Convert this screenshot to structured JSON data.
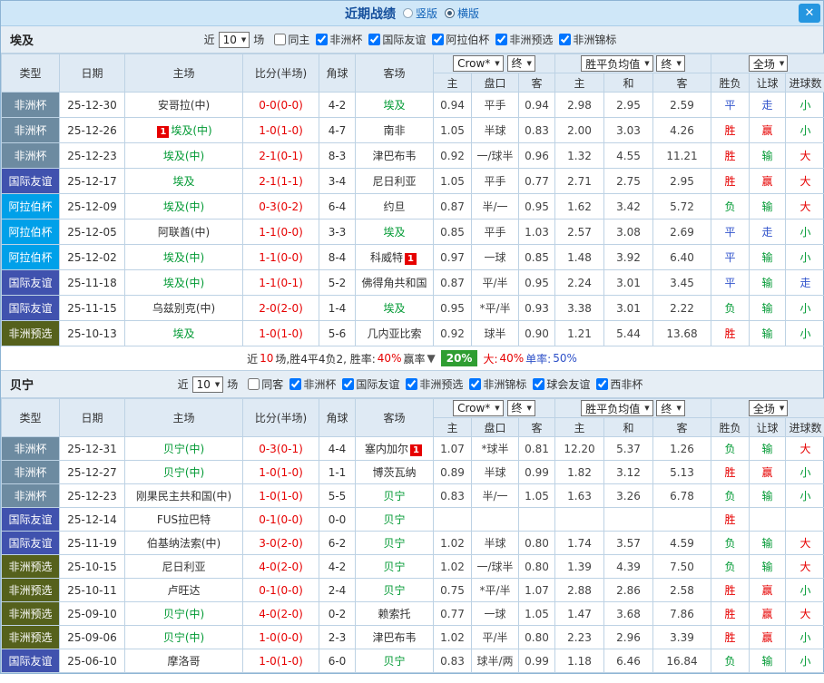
{
  "titlebar": {
    "title": "近期战绩",
    "radio_vertical": "竖版",
    "radio_horizontal": "横版",
    "close": "✕"
  },
  "filter": {
    "near_label": "近",
    "near_value": "10",
    "matches_label": "场"
  },
  "table_header": {
    "col_type": "类型",
    "col_date": "日期",
    "col_home": "主场",
    "col_score": "比分(半场)",
    "col_corner": "角球",
    "col_away": "客场",
    "odds_select1": "Crow*",
    "odds_select2": "终",
    "avg_select1": "胜平负均值",
    "avg_select2": "终",
    "scope_select": "全场",
    "sub_home": "主",
    "sub_handicap": "盘口",
    "sub_away": "客",
    "sub_avg_home": "主",
    "sub_avg_draw": "和",
    "sub_avg_away": "客",
    "col_result": "胜负",
    "col_handicap_result": "让球",
    "col_goals": "进球数"
  },
  "type_colors": {
    "非洲杯": "#6d8ba1",
    "国际友谊": "#4052ae",
    "阿拉伯杯": "#00a0e9",
    "非洲预选": "#55611c"
  },
  "result_colors": {
    "red": "#e60000",
    "green": "#009933",
    "blue": "#3355cc"
  },
  "sections": [
    {
      "team": "埃及",
      "filters": [
        {
          "label": "同主",
          "checked": false
        },
        {
          "label": "非洲杯",
          "checked": true
        },
        {
          "label": "国际友谊",
          "checked": true
        },
        {
          "label": "阿拉伯杯",
          "checked": true
        },
        {
          "label": "非洲预选",
          "checked": true
        },
        {
          "label": "非洲锦标",
          "checked": true
        }
      ],
      "rows": [
        {
          "type": "非洲杯",
          "date": "25-12-30",
          "home": "安哥拉(中)",
          "home_focus": false,
          "home_badge": "",
          "home_badge_pos": "",
          "score": "0-0(0-0)",
          "corner": "4-2",
          "away": "埃及",
          "away_focus": true,
          "away_badge": "",
          "away_badge_pos": "",
          "odds": [
            "0.94",
            "平手",
            "0.94"
          ],
          "avg": [
            "2.98",
            "2.95",
            "2.59"
          ],
          "results": [
            {
              "t": "平",
              "c": "blue"
            },
            {
              "t": "走",
              "c": "blue"
            },
            {
              "t": "小",
              "c": "green"
            }
          ]
        },
        {
          "type": "非洲杯",
          "date": "25-12-26",
          "home": "埃及(中)",
          "home_focus": true,
          "home_badge": "1",
          "home_badge_pos": "before",
          "score": "1-0(1-0)",
          "corner": "4-7",
          "away": "南非",
          "away_focus": false,
          "away_badge": "",
          "away_badge_pos": "",
          "odds": [
            "1.05",
            "半球",
            "0.83"
          ],
          "avg": [
            "2.00",
            "3.03",
            "4.26"
          ],
          "results": [
            {
              "t": "胜",
              "c": "red"
            },
            {
              "t": "赢",
              "c": "red"
            },
            {
              "t": "小",
              "c": "green"
            }
          ]
        },
        {
          "type": "非洲杯",
          "date": "25-12-23",
          "home": "埃及(中)",
          "home_focus": true,
          "home_badge": "",
          "home_badge_pos": "",
          "score": "2-1(0-1)",
          "corner": "8-3",
          "away": "津巴布韦",
          "away_focus": false,
          "away_badge": "",
          "away_badge_pos": "",
          "odds": [
            "0.92",
            "一/球半",
            "0.96"
          ],
          "avg": [
            "1.32",
            "4.55",
            "11.21"
          ],
          "results": [
            {
              "t": "胜",
              "c": "red"
            },
            {
              "t": "输",
              "c": "green"
            },
            {
              "t": "大",
              "c": "red"
            }
          ]
        },
        {
          "type": "国际友谊",
          "date": "25-12-17",
          "home": "埃及",
          "home_focus": true,
          "home_badge": "",
          "home_badge_pos": "",
          "score": "2-1(1-1)",
          "corner": "3-4",
          "away": "尼日利亚",
          "away_focus": false,
          "away_badge": "",
          "away_badge_pos": "",
          "odds": [
            "1.05",
            "平手",
            "0.77"
          ],
          "avg": [
            "2.71",
            "2.75",
            "2.95"
          ],
          "results": [
            {
              "t": "胜",
              "c": "red"
            },
            {
              "t": "赢",
              "c": "red"
            },
            {
              "t": "大",
              "c": "red"
            }
          ]
        },
        {
          "type": "阿拉伯杯",
          "date": "25-12-09",
          "home": "埃及(中)",
          "home_focus": true,
          "home_badge": "",
          "home_badge_pos": "",
          "score": "0-3(0-2)",
          "corner": "6-4",
          "away": "约旦",
          "away_focus": false,
          "away_badge": "",
          "away_badge_pos": "",
          "odds": [
            "0.87",
            "半/一",
            "0.95"
          ],
          "avg": [
            "1.62",
            "3.42",
            "5.72"
          ],
          "results": [
            {
              "t": "负",
              "c": "green"
            },
            {
              "t": "输",
              "c": "green"
            },
            {
              "t": "大",
              "c": "red"
            }
          ]
        },
        {
          "type": "阿拉伯杯",
          "date": "25-12-05",
          "home": "阿联酋(中)",
          "home_focus": false,
          "home_badge": "",
          "home_badge_pos": "",
          "score": "1-1(0-0)",
          "corner": "3-3",
          "away": "埃及",
          "away_focus": true,
          "away_badge": "",
          "away_badge_pos": "",
          "odds": [
            "0.85",
            "平手",
            "1.03"
          ],
          "avg": [
            "2.57",
            "3.08",
            "2.69"
          ],
          "results": [
            {
              "t": "平",
              "c": "blue"
            },
            {
              "t": "走",
              "c": "blue"
            },
            {
              "t": "小",
              "c": "green"
            }
          ]
        },
        {
          "type": "阿拉伯杯",
          "date": "25-12-02",
          "home": "埃及(中)",
          "home_focus": true,
          "home_badge": "",
          "home_badge_pos": "",
          "score": "1-1(0-0)",
          "corner": "8-4",
          "away": "科威特",
          "away_focus": false,
          "away_badge": "1",
          "away_badge_pos": "after",
          "odds": [
            "0.97",
            "一球",
            "0.85"
          ],
          "avg": [
            "1.48",
            "3.92",
            "6.40"
          ],
          "results": [
            {
              "t": "平",
              "c": "blue"
            },
            {
              "t": "输",
              "c": "green"
            },
            {
              "t": "小",
              "c": "green"
            }
          ]
        },
        {
          "type": "国际友谊",
          "date": "25-11-18",
          "home": "埃及(中)",
          "home_focus": true,
          "home_badge": "",
          "home_badge_pos": "",
          "score": "1-1(0-1)",
          "corner": "5-2",
          "away": "佛得角共和国",
          "away_focus": false,
          "away_badge": "",
          "away_badge_pos": "",
          "odds": [
            "0.87",
            "平/半",
            "0.95"
          ],
          "avg": [
            "2.24",
            "3.01",
            "3.45"
          ],
          "results": [
            {
              "t": "平",
              "c": "blue"
            },
            {
              "t": "输",
              "c": "green"
            },
            {
              "t": "走",
              "c": "blue"
            }
          ]
        },
        {
          "type": "国际友谊",
          "date": "25-11-15",
          "home": "乌兹别克(中)",
          "home_focus": false,
          "home_badge": "",
          "home_badge_pos": "",
          "score": "2-0(2-0)",
          "corner": "1-4",
          "away": "埃及",
          "away_focus": true,
          "away_badge": "",
          "away_badge_pos": "",
          "odds": [
            "0.95",
            "*平/半",
            "0.93"
          ],
          "avg": [
            "3.38",
            "3.01",
            "2.22"
          ],
          "results": [
            {
              "t": "负",
              "c": "green"
            },
            {
              "t": "输",
              "c": "green"
            },
            {
              "t": "小",
              "c": "green"
            }
          ]
        },
        {
          "type": "非洲预选",
          "date": "25-10-13",
          "home": "埃及",
          "home_focus": true,
          "home_badge": "",
          "home_badge_pos": "",
          "score": "1-0(1-0)",
          "corner": "5-6",
          "away": "几内亚比索",
          "away_focus": false,
          "away_badge": "",
          "away_badge_pos": "",
          "odds": [
            "0.92",
            "球半",
            "0.90"
          ],
          "avg": [
            "1.21",
            "5.44",
            "13.68"
          ],
          "results": [
            {
              "t": "胜",
              "c": "red"
            },
            {
              "t": "输",
              "c": "green"
            },
            {
              "t": "小",
              "c": "green"
            }
          ]
        }
      ],
      "summary": {
        "before": [
          {
            "t": "近",
            "c": "#333333"
          },
          {
            "t": "10",
            "c": "#e60000"
          },
          {
            "t": "场,胜4平4负2, 胜率:",
            "c": "#333333"
          },
          {
            "t": "40%",
            "c": "#e60000"
          },
          {
            "t": " 赢率",
            "c": "#333333"
          },
          {
            "t": "▼",
            "c": "#555555"
          }
        ],
        "badge": "20%",
        "badge_bg": "#2f9e32",
        "after": [
          {
            "t": "大:",
            "c": "#e60000"
          },
          {
            "t": "40%",
            "c": "#e60000"
          },
          {
            "t": " 单率:",
            "c": "#2d50c8"
          },
          {
            "t": "50%",
            "c": "#2d50c8"
          }
        ]
      }
    },
    {
      "team": "贝宁",
      "filters": [
        {
          "label": "同客",
          "checked": false
        },
        {
          "label": "非洲杯",
          "checked": true
        },
        {
          "label": "国际友谊",
          "checked": true
        },
        {
          "label": "非洲预选",
          "checked": true
        },
        {
          "label": "非洲锦标",
          "checked": true
        },
        {
          "label": "球会友谊",
          "checked": true
        },
        {
          "label": "西非杯",
          "checked": true
        }
      ],
      "rows": [
        {
          "type": "非洲杯",
          "date": "25-12-31",
          "home": "贝宁(中)",
          "home_focus": true,
          "home_badge": "",
          "home_badge_pos": "",
          "score": "0-3(0-1)",
          "corner": "4-4",
          "away": "塞内加尔",
          "away_focus": false,
          "away_badge": "1",
          "away_badge_pos": "after",
          "odds": [
            "1.07",
            "*球半",
            "0.81"
          ],
          "avg": [
            "12.20",
            "5.37",
            "1.26"
          ],
          "results": [
            {
              "t": "负",
              "c": "green"
            },
            {
              "t": "输",
              "c": "green"
            },
            {
              "t": "大",
              "c": "red"
            }
          ]
        },
        {
          "type": "非洲杯",
          "date": "25-12-27",
          "home": "贝宁(中)",
          "home_focus": true,
          "home_badge": "",
          "home_badge_pos": "",
          "score": "1-0(1-0)",
          "corner": "1-1",
          "away": "博茨瓦纳",
          "away_focus": false,
          "away_badge": "",
          "away_badge_pos": "",
          "odds": [
            "0.89",
            "半球",
            "0.99"
          ],
          "avg": [
            "1.82",
            "3.12",
            "5.13"
          ],
          "results": [
            {
              "t": "胜",
              "c": "red"
            },
            {
              "t": "赢",
              "c": "red"
            },
            {
              "t": "小",
              "c": "green"
            }
          ]
        },
        {
          "type": "非洲杯",
          "date": "25-12-23",
          "home": "刚果民主共和国(中)",
          "home_focus": false,
          "home_badge": "",
          "home_badge_pos": "",
          "score": "1-0(1-0)",
          "corner": "5-5",
          "away": "贝宁",
          "away_focus": true,
          "away_badge": "",
          "away_badge_pos": "",
          "odds": [
            "0.83",
            "半/一",
            "1.05"
          ],
          "avg": [
            "1.63",
            "3.26",
            "6.78"
          ],
          "results": [
            {
              "t": "负",
              "c": "green"
            },
            {
              "t": "输",
              "c": "green"
            },
            {
              "t": "小",
              "c": "green"
            }
          ]
        },
        {
          "type": "国际友谊",
          "date": "25-12-14",
          "home": "FUS拉巴特",
          "home_focus": false,
          "home_badge": "",
          "home_badge_pos": "",
          "score": "0-1(0-0)",
          "corner": "0-0",
          "away": "贝宁",
          "away_focus": true,
          "away_badge": "",
          "away_badge_pos": "",
          "odds": [
            "",
            "",
            ""
          ],
          "avg": [
            "",
            "",
            ""
          ],
          "results": [
            {
              "t": "胜",
              "c": "red"
            },
            {
              "t": "",
              "c": "blue"
            },
            {
              "t": "",
              "c": "blue"
            }
          ]
        },
        {
          "type": "国际友谊",
          "date": "25-11-19",
          "home": "伯基纳法索(中)",
          "home_focus": false,
          "home_badge": "",
          "home_badge_pos": "",
          "score": "3-0(2-0)",
          "corner": "6-2",
          "away": "贝宁",
          "away_focus": true,
          "away_badge": "",
          "away_badge_pos": "",
          "odds": [
            "1.02",
            "半球",
            "0.80"
          ],
          "avg": [
            "1.74",
            "3.57",
            "4.59"
          ],
          "results": [
            {
              "t": "负",
              "c": "green"
            },
            {
              "t": "输",
              "c": "green"
            },
            {
              "t": "大",
              "c": "red"
            }
          ]
        },
        {
          "type": "非洲预选",
          "date": "25-10-15",
          "home": "尼日利亚",
          "home_focus": false,
          "home_badge": "",
          "home_badge_pos": "",
          "score": "4-0(2-0)",
          "corner": "4-2",
          "away": "贝宁",
          "away_focus": true,
          "away_badge": "",
          "away_badge_pos": "",
          "odds": [
            "1.02",
            "一/球半",
            "0.80"
          ],
          "avg": [
            "1.39",
            "4.39",
            "7.50"
          ],
          "results": [
            {
              "t": "负",
              "c": "green"
            },
            {
              "t": "输",
              "c": "green"
            },
            {
              "t": "大",
              "c": "red"
            }
          ]
        },
        {
          "type": "非洲预选",
          "date": "25-10-11",
          "home": "卢旺达",
          "home_focus": false,
          "home_badge": "",
          "home_badge_pos": "",
          "score": "0-1(0-0)",
          "corner": "2-4",
          "away": "贝宁",
          "away_focus": true,
          "away_badge": "",
          "away_badge_pos": "",
          "odds": [
            "0.75",
            "*平/半",
            "1.07"
          ],
          "avg": [
            "2.88",
            "2.86",
            "2.58"
          ],
          "results": [
            {
              "t": "胜",
              "c": "red"
            },
            {
              "t": "赢",
              "c": "red"
            },
            {
              "t": "小",
              "c": "green"
            }
          ]
        },
        {
          "type": "非洲预选",
          "date": "25-09-10",
          "home": "贝宁(中)",
          "home_focus": true,
          "home_badge": "",
          "home_badge_pos": "",
          "score": "4-0(2-0)",
          "corner": "0-2",
          "away": "赖索托",
          "away_focus": false,
          "away_badge": "",
          "away_badge_pos": "",
          "odds": [
            "0.77",
            "一球",
            "1.05"
          ],
          "avg": [
            "1.47",
            "3.68",
            "7.86"
          ],
          "results": [
            {
              "t": "胜",
              "c": "red"
            },
            {
              "t": "赢",
              "c": "red"
            },
            {
              "t": "大",
              "c": "red"
            }
          ]
        },
        {
          "type": "非洲预选",
          "date": "25-09-06",
          "home": "贝宁(中)",
          "home_focus": true,
          "home_badge": "",
          "home_badge_pos": "",
          "score": "1-0(0-0)",
          "corner": "2-3",
          "away": "津巴布韦",
          "away_focus": false,
          "away_badge": "",
          "away_badge_pos": "",
          "odds": [
            "1.02",
            "平/半",
            "0.80"
          ],
          "avg": [
            "2.23",
            "2.96",
            "3.39"
          ],
          "results": [
            {
              "t": "胜",
              "c": "red"
            },
            {
              "t": "赢",
              "c": "red"
            },
            {
              "t": "小",
              "c": "green"
            }
          ]
        },
        {
          "type": "国际友谊",
          "date": "25-06-10",
          "home": "摩洛哥",
          "home_focus": false,
          "home_badge": "",
          "home_badge_pos": "",
          "score": "1-0(1-0)",
          "corner": "6-0",
          "away": "贝宁",
          "away_focus": true,
          "away_badge": "",
          "away_badge_pos": "",
          "odds": [
            "0.83",
            "球半/两",
            "0.99"
          ],
          "avg": [
            "1.18",
            "6.46",
            "16.84"
          ],
          "results": [
            {
              "t": "负",
              "c": "green"
            },
            {
              "t": "输",
              "c": "green"
            },
            {
              "t": "小",
              "c": "green"
            }
          ]
        }
      ],
      "summary": null
    }
  ]
}
